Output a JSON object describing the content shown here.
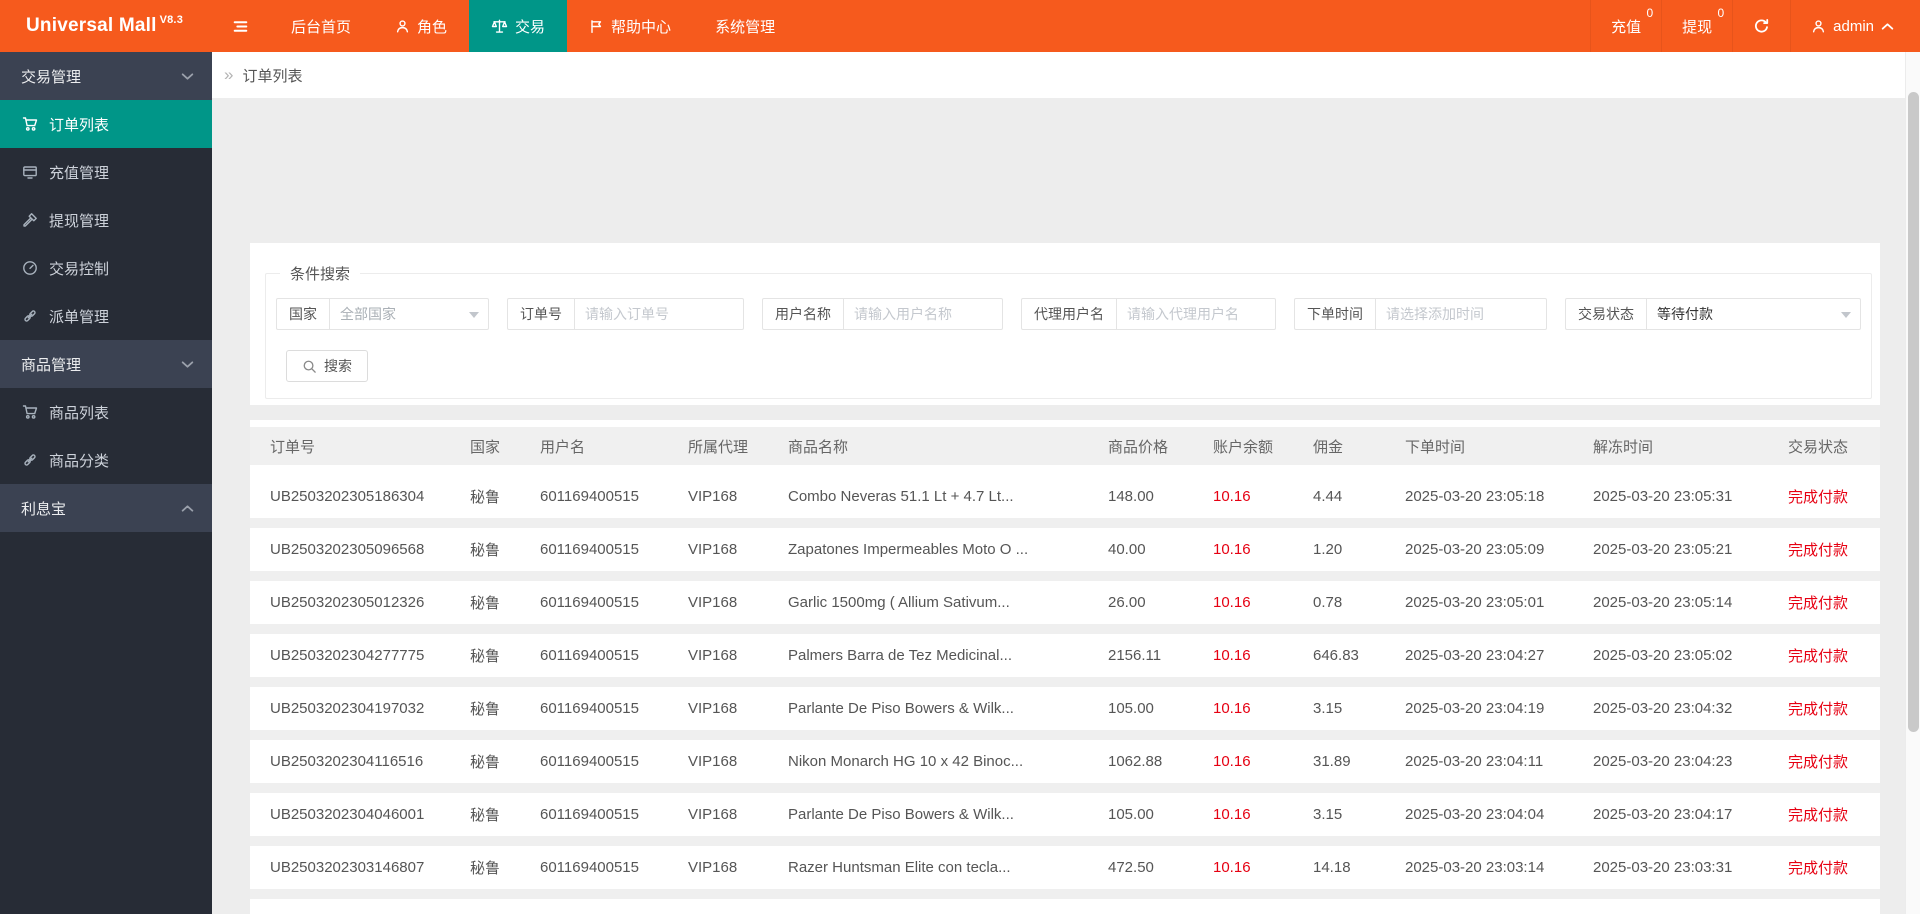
{
  "colors": {
    "topbar_orange": "#f65a1d",
    "accent_teal": "#009688",
    "sidebar_dark": "#272c36",
    "sidebar_group": "#3b4252",
    "alert_red": "#e60012",
    "page_gray": "#ededed"
  },
  "brand": {
    "name": "Universal Mall",
    "version": "V8.3"
  },
  "nav": {
    "home": "后台首页",
    "role": "角色",
    "trade": "交易",
    "help": "帮助中心",
    "system": "系统管理"
  },
  "topbar": {
    "recharge": "充值",
    "recharge_badge": "0",
    "withdraw": "提现",
    "withdraw_badge": "0",
    "username": "admin"
  },
  "sidebar": {
    "group_trade": "交易管理",
    "order_list": "订单列表",
    "recharge_mgmt": "充值管理",
    "withdraw_mgmt": "提现管理",
    "trade_control": "交易控制",
    "dispatch_mgmt": "派单管理",
    "group_goods": "商品管理",
    "goods_list": "商品列表",
    "goods_category": "商品分类",
    "group_interest": "利息宝"
  },
  "breadcrumb": {
    "arrow": "»",
    "current": "订单列表"
  },
  "search": {
    "legend": "条件搜索",
    "country_label": "国家",
    "country_value": "全部国家",
    "order_label": "订单号",
    "order_placeholder": "请输入订单号",
    "user_label": "用户名称",
    "user_placeholder": "请输入用户名称",
    "agent_label": "代理用户名",
    "agent_placeholder": "请输入代理用户名",
    "time_label": "下单时间",
    "time_placeholder": "请选择添加时间",
    "status_label": "交易状态",
    "status_value": "等待付款",
    "button": "搜索"
  },
  "table": {
    "columns": [
      "订单号",
      "国家",
      "用户名",
      "所属代理",
      "商品名称",
      "商品价格",
      "账户余额",
      "佣金",
      "下单时间",
      "解冻时间",
      "交易状态"
    ],
    "rows": [
      {
        "order_no": "UB2503202305186304",
        "country": "秘鲁",
        "username": "601169400515",
        "agent": "VIP168",
        "product": "Combo Neveras 51.1 Lt + 4.7 Lt...",
        "price": "148.00",
        "balance": "10.16",
        "commission": "4.44",
        "order_time": "2025-03-20 23:05:18",
        "unfreeze_time": "2025-03-20 23:05:31",
        "status": "完成付款"
      },
      {
        "order_no": "UB2503202305096568",
        "country": "秘鲁",
        "username": "601169400515",
        "agent": "VIP168",
        "product": "Zapatones Impermeables Moto O ...",
        "price": "40.00",
        "balance": "10.16",
        "commission": "1.20",
        "order_time": "2025-03-20 23:05:09",
        "unfreeze_time": "2025-03-20 23:05:21",
        "status": "完成付款"
      },
      {
        "order_no": "UB2503202305012326",
        "country": "秘鲁",
        "username": "601169400515",
        "agent": "VIP168",
        "product": "Garlic 1500mg ( Allium Sativum...",
        "price": "26.00",
        "balance": "10.16",
        "commission": "0.78",
        "order_time": "2025-03-20 23:05:01",
        "unfreeze_time": "2025-03-20 23:05:14",
        "status": "完成付款"
      },
      {
        "order_no": "UB2503202304277775",
        "country": "秘鲁",
        "username": "601169400515",
        "agent": "VIP168",
        "product": "Palmers Barra de Tez Medicinal...",
        "price": "2156.11",
        "balance": "10.16",
        "commission": "646.83",
        "order_time": "2025-03-20 23:04:27",
        "unfreeze_time": "2025-03-20 23:05:02",
        "status": "完成付款"
      },
      {
        "order_no": "UB2503202304197032",
        "country": "秘鲁",
        "username": "601169400515",
        "agent": "VIP168",
        "product": "Parlante De Piso Bowers & Wilk...",
        "price": "105.00",
        "balance": "10.16",
        "commission": "3.15",
        "order_time": "2025-03-20 23:04:19",
        "unfreeze_time": "2025-03-20 23:04:32",
        "status": "完成付款"
      },
      {
        "order_no": "UB2503202304116516",
        "country": "秘鲁",
        "username": "601169400515",
        "agent": "VIP168",
        "product": "Nikon Monarch HG 10 x 42 Binoc...",
        "price": "1062.88",
        "balance": "10.16",
        "commission": "31.89",
        "order_time": "2025-03-20 23:04:11",
        "unfreeze_time": "2025-03-20 23:04:23",
        "status": "完成付款"
      },
      {
        "order_no": "UB2503202304046001",
        "country": "秘鲁",
        "username": "601169400515",
        "agent": "VIP168",
        "product": "Parlante De Piso Bowers & Wilk...",
        "price": "105.00",
        "balance": "10.16",
        "commission": "3.15",
        "order_time": "2025-03-20 23:04:04",
        "unfreeze_time": "2025-03-20 23:04:17",
        "status": "完成付款"
      },
      {
        "order_no": "UB2503202303146807",
        "country": "秘鲁",
        "username": "601169400515",
        "agent": "VIP168",
        "product": "Razer Huntsman Elite con tecla...",
        "price": "472.50",
        "balance": "10.16",
        "commission": "14.18",
        "order_time": "2025-03-20 23:03:14",
        "unfreeze_time": "2025-03-20 23:03:31",
        "status": "完成付款"
      }
    ]
  }
}
